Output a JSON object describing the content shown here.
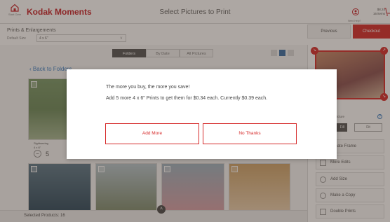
{
  "header": {
    "home_label": "Start Over",
    "app_title": "Kodak Moments",
    "page_title": "Select Pictures to Print",
    "help_label": "Need Help?",
    "cart_total": "$8.24",
    "cart_items": "16 items"
  },
  "toolbar": {
    "section_title": "Prints & Enlargements",
    "size_label": "Default Size",
    "size_value": "4 x 6\"",
    "previous_label": "Previous",
    "checkout_label": "Checkout"
  },
  "view_tabs": [
    {
      "label": "Folders",
      "active": true
    },
    {
      "label": "By Date",
      "active": false
    },
    {
      "label": "All Pictures",
      "active": false
    }
  ],
  "main": {
    "back_label": "Back to Folders",
    "first_photo_name": "Sightseeing",
    "first_photo_size": "4 x 6\"",
    "first_photo_qty": "5"
  },
  "footer": {
    "selected_products": "Selected Products: 16"
  },
  "sidebar": {
    "print_note": "print entire picture",
    "fill_label": "Fill",
    "fit_label": "Fit",
    "actions": [
      {
        "label": "Create Frame",
        "icon": "frame-icon"
      },
      {
        "label": "More Edits",
        "icon": "edit-icon"
      },
      {
        "label": "Add Size",
        "icon": "add-icon"
      },
      {
        "label": "Make a Copy",
        "icon": "copy-icon"
      },
      {
        "label": "Double Prints",
        "icon": "double-icon"
      }
    ]
  },
  "modal": {
    "line1": "The more you buy, the more you save!",
    "line2": "Add 5 more 4 x 6\" Prints to get them for $0.34 each. Currently $0.39 each.",
    "add_more_label": "Add More",
    "no_thanks_label": "No Thanks"
  },
  "colors": {
    "brand_red": "#d62b2b",
    "link_blue": "#3b7fc4"
  }
}
